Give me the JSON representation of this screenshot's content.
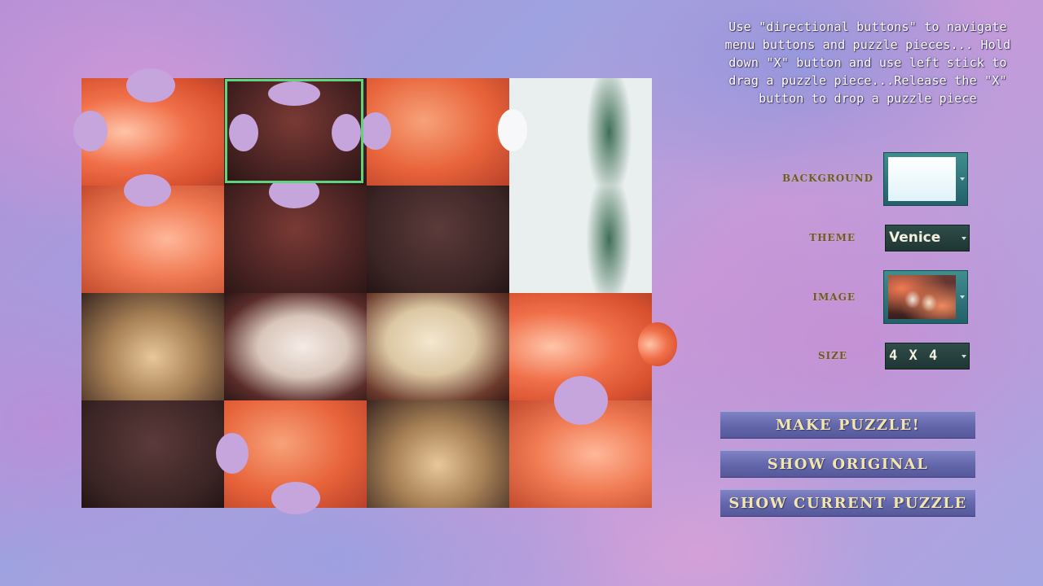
{
  "instructions": {
    "text": "Use \"directional buttons\" to navigate menu buttons and puzzle pieces... Hold down \"X\" button and use left stick to drag a puzzle piece...Release the \"X\" button to drop a puzzle piece"
  },
  "settings": {
    "background": {
      "label": "BACKGROUND",
      "preview_color": "#e9f6fb"
    },
    "theme": {
      "label": "THEME",
      "value": "Venice"
    },
    "image": {
      "label": "IMAGE",
      "thumbnail": "venetian-masks-thumbnail"
    },
    "size": {
      "label": "SIZE",
      "value": "4 X 4"
    }
  },
  "buttons": {
    "make_puzzle": "MAKE PUZZLE!",
    "show_original": "SHOW ORIGINAL",
    "show_current": "SHOW CURRENT PUZZLE"
  },
  "puzzle": {
    "grid": "4 X 4",
    "selection_color": "#5fd47a",
    "image_subject": "venetian-carnival-masks"
  }
}
